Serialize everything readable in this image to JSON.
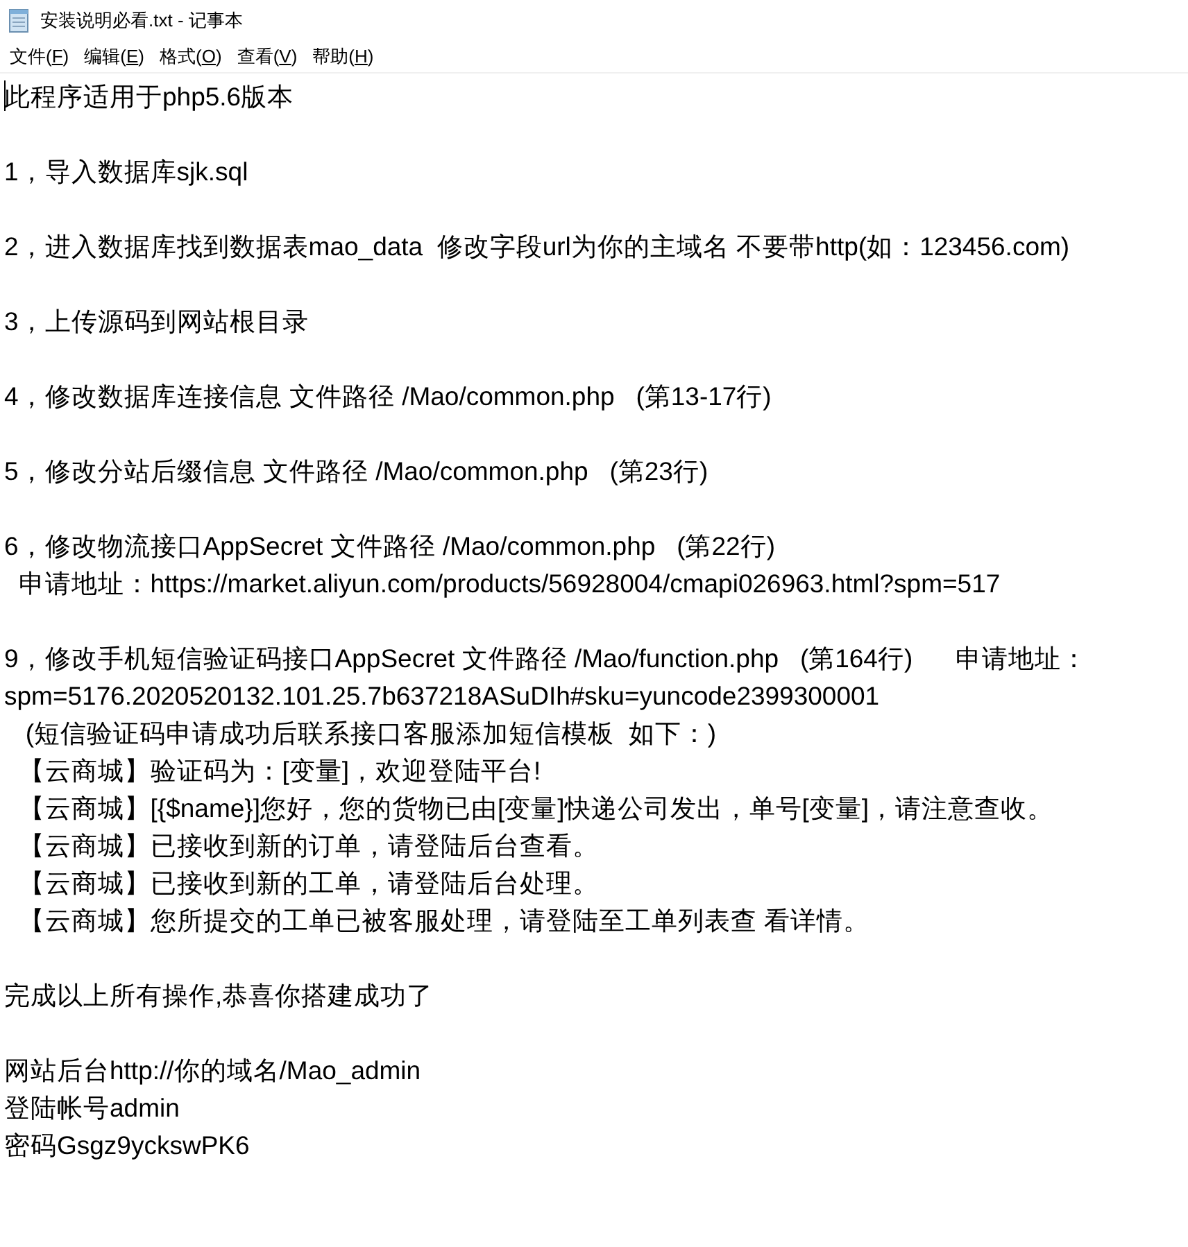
{
  "window": {
    "title": "安装说明必看.txt - 记事本"
  },
  "menu": [
    {
      "label": "文件(F)"
    },
    {
      "label": "编辑(E)"
    },
    {
      "label": "格式(O)"
    },
    {
      "label": "查看(V)"
    },
    {
      "label": "帮助(H)"
    }
  ],
  "document": {
    "paragraphs": [
      {
        "lines": [
          "此程序适用于php5.6版本"
        ]
      },
      {
        "lines": [
          "1，导入数据库sjk.sql"
        ]
      },
      {
        "lines": [
          "2，进入数据库找到数据表mao_data  修改字段url为你的主域名 不要带http(如：123456.com)"
        ]
      },
      {
        "lines": [
          "3，上传源码到网站根目录"
        ]
      },
      {
        "lines": [
          "4，修改数据库连接信息 文件路径 /Mao/common.php   (第13-17行)"
        ]
      },
      {
        "lines": [
          "5，修改分站后缀信息 文件路径 /Mao/common.php   (第23行)"
        ]
      },
      {
        "lines": [
          "6，修改物流接口AppSecret 文件路径 /Mao/common.php   (第22行)",
          "  申请地址：https://market.aliyun.com/products/56928004/cmapi026963.html?spm=517"
        ]
      },
      {
        "lines": [
          "9，修改手机短信验证码接口AppSecret 文件路径 /Mao/function.php   (第164行)      申请地址：",
          "spm=5176.2020520132.101.25.7b637218ASuDIh#sku=yuncode2399300001",
          "   (短信验证码申请成功后联系接口客服添加短信模板  如下：)",
          "  【云商城】验证码为：[变量]，欢迎登陆平台!",
          "  【云商城】[{$name}]您好，您的货物已由[变量]快递公司发出，单号[变量]，请注意查收。",
          "  【云商城】已接收到新的订单，请登陆后台查看。",
          "  【云商城】已接收到新的工单，请登陆后台处理。",
          "  【云商城】您所提交的工单已被客服处理，请登陆至工单列表查 看详情。"
        ]
      },
      {
        "lines": [
          "完成以上所有操作,恭喜你搭建成功了"
        ]
      },
      {
        "lines": [
          "网站后台http://你的域名/Mao_admin",
          "登陆帐号admin",
          "密码Gsgz9yckswPK6"
        ]
      }
    ]
  }
}
